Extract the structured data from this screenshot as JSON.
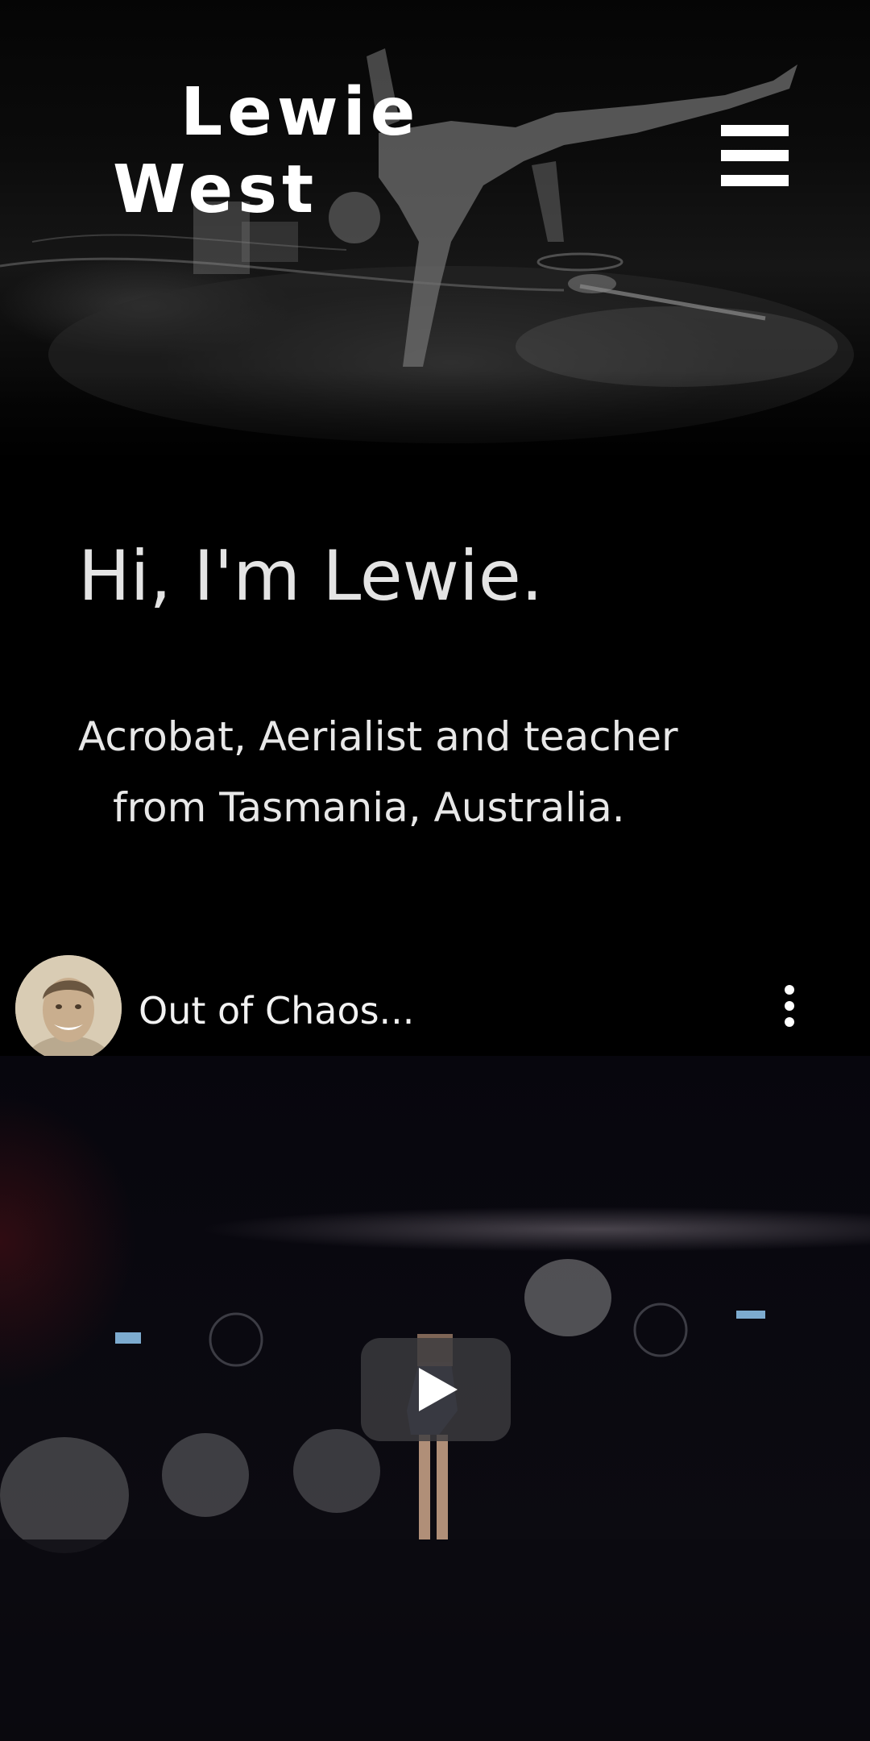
{
  "header": {
    "title_line1": "Lewie",
    "title_line2": "West",
    "menu_icon": "hamburger-menu-icon"
  },
  "intro": {
    "heading": "Hi, I'm Lewie.",
    "description_line1": "Acrobat, Aerialist and teacher",
    "description_line2": "from Tasmania, Australia."
  },
  "video": {
    "title": "Out of Chaos...",
    "more_icon": "more-vertical-icon",
    "play_icon": "play-icon"
  },
  "colors": {
    "background": "#000000",
    "text": "#ffffff",
    "play_button_bg": "#3c3c40"
  }
}
